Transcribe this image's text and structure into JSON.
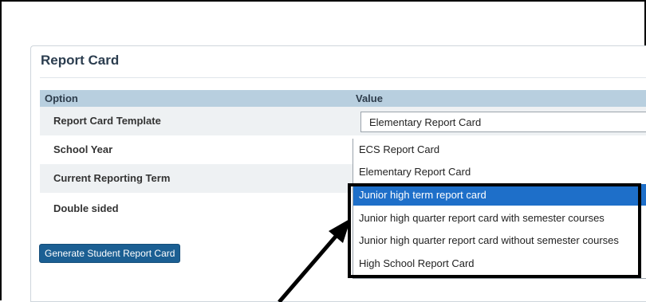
{
  "panel": {
    "title": "Report Card"
  },
  "table": {
    "headers": {
      "option": "Option",
      "value": "Value"
    },
    "rows": [
      {
        "label": "Report Card Template"
      },
      {
        "label": "School Year"
      },
      {
        "label": "Current Reporting Term"
      },
      {
        "label": "Double sided"
      }
    ]
  },
  "template_select": {
    "value": "Elementary Report Card"
  },
  "dropdown": {
    "options": [
      "ECS Report Card",
      "Elementary Report Card",
      "Junior high term report card",
      "Junior high quarter report card with semester courses",
      "Junior high quarter report card without semester courses",
      "High School Report Card"
    ],
    "highlighted": "Junior high term report card"
  },
  "buttons": {
    "generate": "Generate Student Report Card"
  },
  "colors": {
    "header_bg": "#b8cfdf",
    "button_bg": "#1b5f93",
    "selected_bg": "#1e6fc9"
  }
}
